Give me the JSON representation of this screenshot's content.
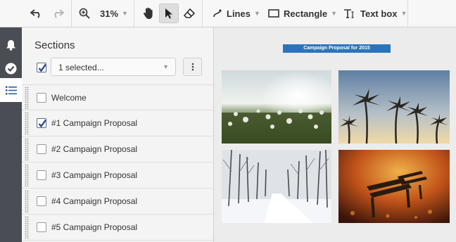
{
  "toolbar": {
    "zoom": "31%",
    "lines_label": "Lines",
    "rectangle_label": "Rectangle",
    "textbox_label": "Text box"
  },
  "sidebar": {
    "title": "Sections",
    "selection_text": "1 selected...",
    "items": [
      {
        "label": "Welcome",
        "checked": false
      },
      {
        "label": "#1 Campaign Proposal",
        "checked": true
      },
      {
        "label": "#2 Campaign Proposal",
        "checked": false
      },
      {
        "label": "#3 Campaign Proposal",
        "checked": false
      },
      {
        "label": "#4 Campaign Proposal",
        "checked": false
      },
      {
        "label": "#5 Campaign Proposal",
        "checked": false
      }
    ]
  },
  "canvas": {
    "banner_title": "Campaign Proposal for 2015",
    "photos": [
      "dandelion-field",
      "palm-trees",
      "snowy-forest-road",
      "autumn-park-bench"
    ]
  },
  "colors": {
    "banner": "#2b74bd",
    "rail": "#4a4e54",
    "checkbox_accent": "#2f4f8a"
  }
}
